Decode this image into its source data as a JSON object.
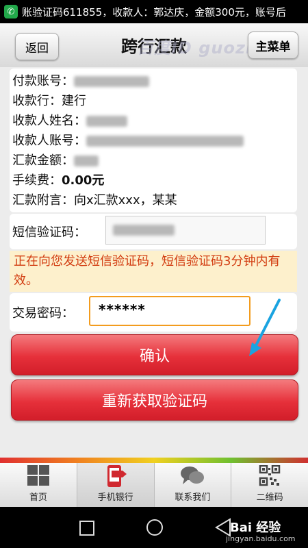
{
  "status_bar": {
    "notification": "账验证码611855，收款人：郭达庆，金额300元，账号后"
  },
  "header": {
    "back_label": "返回",
    "title": "跨行汇款",
    "menu_label": "主菜单",
    "watermark": "百度ID guozi"
  },
  "transfer": {
    "payer_account_label": "付款账号：",
    "bank_label": "收款行：",
    "bank_value": "建行",
    "payee_name_label": "收款人姓名：",
    "payee_account_label": "收款人账号：",
    "amount_label": "汇款金额：",
    "fee_label": "手续费：",
    "fee_value": "0.00元",
    "remark_label": "汇款附言：",
    "remark_value": "向x汇款xxx，某某"
  },
  "sms": {
    "label": "短信验证码："
  },
  "notice": "正在向您发送短信验证码，短信验证码3分钟内有效。",
  "password": {
    "label": "交易密码：",
    "value": "******"
  },
  "buttons": {
    "confirm": "确认",
    "resend": "重新获取验证码"
  },
  "tabs": [
    {
      "label": "首页",
      "icon": "grid-icon"
    },
    {
      "label": "手机银行",
      "icon": "mobile-bank-icon"
    },
    {
      "label": "联系我们",
      "icon": "chat-icon"
    },
    {
      "label": "二维码",
      "icon": "qrcode-icon"
    }
  ],
  "footer_watermark": {
    "brand": "Bai 经验",
    "url": "jingyan.baidu.com"
  },
  "colors": {
    "accent_red": "#e6303a",
    "notice_text": "#d23c10",
    "notice_bg": "#fdf0cc",
    "input_focus": "#f39c1e"
  }
}
